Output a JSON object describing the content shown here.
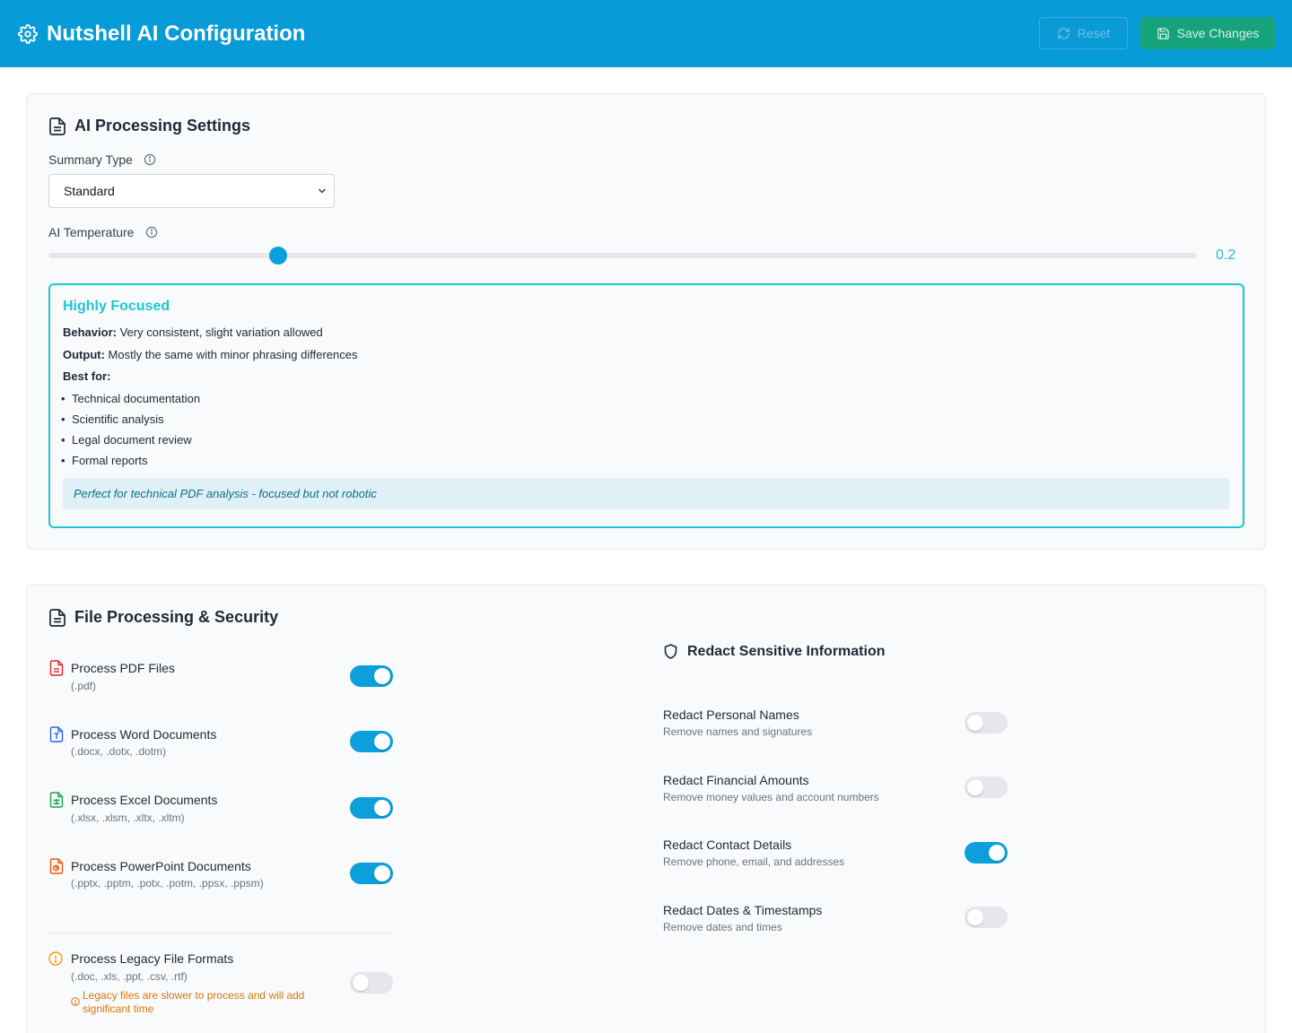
{
  "header": {
    "title": "Nutshell AI Configuration",
    "reset_label": "Reset",
    "save_label": "Save Changes",
    "background": "#079bd8",
    "save_color": "#16a37c"
  },
  "ai_settings": {
    "title": "AI Processing Settings",
    "summary_type_label": "Summary Type",
    "summary_type_value": "Standard",
    "temperature_label": "AI Temperature",
    "temperature_value": "0.2",
    "temperature_fraction": 0.2,
    "mode": {
      "title": "Highly Focused",
      "behavior_label": "Behavior:",
      "behavior_text": "Very consistent, slight variation allowed",
      "output_label": "Output:",
      "output_text": "Mostly the same with minor phrasing differences",
      "best_for_label": "Best for:",
      "best_for": [
        "Technical documentation",
        "Scientific analysis",
        "Legal document review",
        "Formal reports"
      ],
      "note": "Perfect for technical PDF analysis - focused but not robotic",
      "accent": "#1ec6d4"
    }
  },
  "file_processing": {
    "title": "File Processing & Security",
    "files": [
      {
        "title": "Process PDF Files",
        "ext": "(.pdf)",
        "enabled": true,
        "icon": "pdf-file-icon",
        "color": "#dc2626"
      },
      {
        "title": "Process Word Documents",
        "ext": "(.docx, .dotx, .dotm)",
        "enabled": true,
        "icon": "word-file-icon",
        "color": "#2563eb"
      },
      {
        "title": "Process Excel Documents",
        "ext": "(.xlsx, .xlsm, .xltx, .xltm)",
        "enabled": true,
        "icon": "excel-file-icon",
        "color": "#16a34a"
      },
      {
        "title": "Process PowerPoint Documents",
        "ext": "(.pptx, .pptm, .potx, .potm, .ppsx, .ppsm)",
        "enabled": true,
        "icon": "powerpoint-file-icon",
        "color": "#ea580c"
      }
    ],
    "legacy": {
      "title": "Process Legacy File Formats",
      "ext": "(.doc, .xls, .ppt, .csv, .rtf)",
      "warning": "Legacy files are slower to process and will add significant time",
      "enabled": false,
      "color": "#f59e0b"
    },
    "redact": {
      "title": "Redact Sensitive Information",
      "items": [
        {
          "title": "Redact Personal Names",
          "desc": "Remove names and signatures",
          "enabled": false
        },
        {
          "title": "Redact Financial Amounts",
          "desc": "Remove money values and account numbers",
          "enabled": false
        },
        {
          "title": "Redact Contact Details",
          "desc": "Remove phone, email, and addresses",
          "enabled": true
        },
        {
          "title": "Redact Dates & Timestamps",
          "desc": "Remove dates and times",
          "enabled": false
        }
      ]
    }
  }
}
